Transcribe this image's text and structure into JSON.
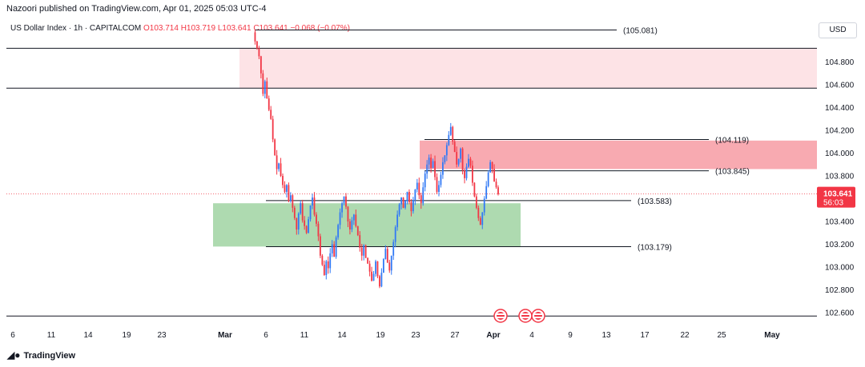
{
  "header": {
    "published": "Nazoori published on TradingView.com, Apr 01, 2025 05:03 UTC-4"
  },
  "symbol": {
    "name": "US Dollar Index · 1h · CAPITALCOM",
    "ohlc": "O103.714 H103.719 L103.641 C103.641 −0.068 (−0.07%)"
  },
  "currency": "USD",
  "logo": "TradingView",
  "colors": {
    "up": "#3179f5",
    "down": "#f23645",
    "supply_zone": "#f7a1a8",
    "supply_zone_faint": "#fde0e3",
    "demand_zone": "#a5d6a7"
  },
  "chart_data": {
    "type": "candlestick",
    "y_axis": {
      "range": [
        102.5,
        105.1
      ],
      "ticks": [
        "104.800",
        "104.600",
        "104.400",
        "104.200",
        "104.000",
        "103.800",
        "103.600",
        "103.400",
        "103.200",
        "103.000",
        "102.800",
        "102.600"
      ],
      "position": "right"
    },
    "x_axis": {
      "ticks": [
        "6",
        "11",
        "14",
        "19",
        "23",
        "Mar",
        "6",
        "11",
        "14",
        "19",
        "23",
        "27",
        "Apr",
        "4",
        "9",
        "13",
        "17",
        "22",
        "25",
        "May"
      ]
    },
    "last_price": {
      "value": "103.641",
      "countdown": "56:03"
    },
    "levels": [
      {
        "label": "(105.081)",
        "value": 105.081
      },
      {
        "label": "(104.119)",
        "value": 104.119
      },
      {
        "label": "(103.845)",
        "value": 103.845
      },
      {
        "label": "(103.583)",
        "value": 103.583
      },
      {
        "label": "(103.179)",
        "value": 103.179
      }
    ],
    "extra_lines": [
      104.92,
      104.57,
      102.57
    ],
    "zones": [
      {
        "type": "supply",
        "top": 104.92,
        "bottom": 104.57
      },
      {
        "type": "supply",
        "top": 104.11,
        "bottom": 103.86
      },
      {
        "type": "demand",
        "top": 103.56,
        "bottom": 103.18
      }
    ],
    "series": [
      {
        "values": [
          105.06,
          104.98,
          104.92,
          104.85,
          104.7,
          104.52,
          104.63,
          104.48,
          104.38,
          104.3,
          104.12,
          103.98,
          103.86,
          103.91,
          103.8,
          103.72,
          103.66,
          103.72,
          103.58,
          103.63,
          103.52,
          103.43,
          103.33,
          103.47,
          103.56,
          103.41,
          103.36,
          103.3,
          103.42,
          103.54,
          103.61,
          103.46,
          103.38,
          103.27,
          103.1,
          103.02,
          102.93,
          103.05,
          102.99,
          103.12,
          103.2,
          103.09,
          103.26,
          103.37,
          103.48,
          103.56,
          103.62,
          103.53,
          103.4,
          103.33,
          103.41,
          103.46,
          103.36,
          103.28,
          103.17,
          103.1,
          103.19,
          103.08,
          103.03,
          102.96,
          102.88,
          102.94,
          103.05,
          102.92,
          102.83,
          102.95,
          103.07,
          103.16,
          103.04,
          102.97,
          103.1,
          103.22,
          103.35,
          103.46,
          103.55,
          103.61,
          103.52,
          103.58,
          103.66,
          103.57,
          103.49,
          103.59,
          103.68,
          103.74,
          103.63,
          103.56,
          103.7,
          103.82,
          103.9,
          103.96,
          103.87,
          103.93,
          103.79,
          103.66,
          103.72,
          103.81,
          103.92,
          103.98,
          104.07,
          104.16,
          104.23,
          104.1,
          104.01,
          103.9,
          103.95,
          104.04,
          103.85,
          103.78,
          103.88,
          103.95,
          103.89,
          103.74,
          103.62,
          103.52,
          103.43,
          103.37,
          103.48,
          103.6,
          103.71,
          103.83,
          103.92,
          103.86,
          103.75,
          103.7,
          103.64
        ]
      }
    ]
  }
}
